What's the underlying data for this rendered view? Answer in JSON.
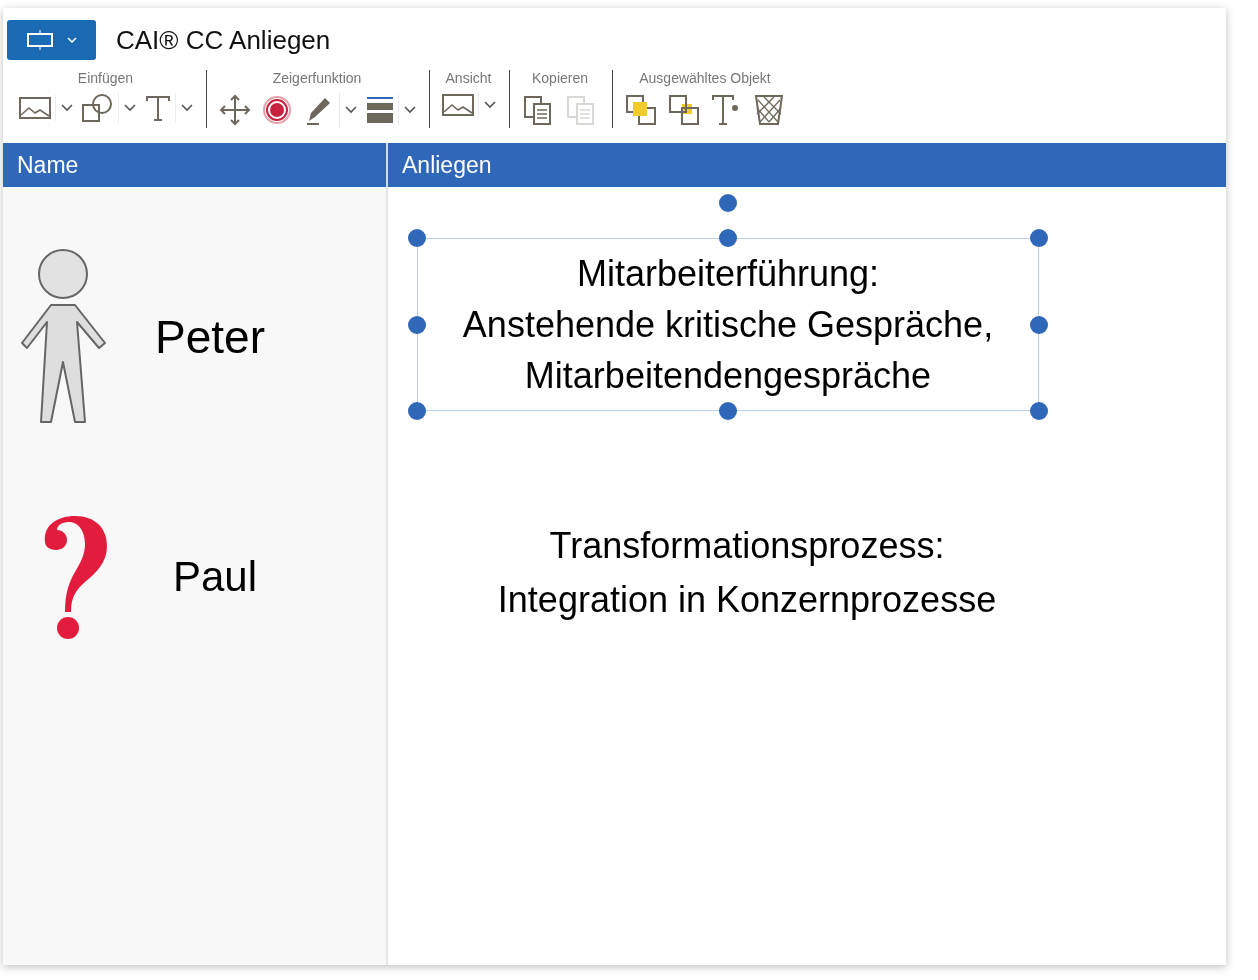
{
  "app_title": "CAI® CC Anliegen",
  "toolbar": [
    {
      "label": "Einfügen",
      "tools": [
        {
          "kind": "image",
          "dropdown": true,
          "disabled": false
        },
        {
          "kind": "shape",
          "dropdown": true,
          "disabled": false
        },
        {
          "kind": "text",
          "dropdown": true,
          "disabled": false
        }
      ]
    },
    {
      "label": "Zeigerfunktion",
      "tools": [
        {
          "kind": "move",
          "dropdown": false,
          "disabled": false
        },
        {
          "kind": "target",
          "dropdown": false,
          "disabled": false
        },
        {
          "kind": "pen",
          "dropdown": true,
          "disabled": false
        },
        {
          "kind": "lines",
          "dropdown": true,
          "disabled": false
        }
      ]
    },
    {
      "label": "Ansicht",
      "tools": [
        {
          "kind": "image",
          "dropdown": true,
          "disabled": false
        }
      ]
    },
    {
      "label": "Kopieren",
      "tools": [
        {
          "kind": "copy",
          "dropdown": false,
          "disabled": false
        },
        {
          "kind": "paste",
          "dropdown": false,
          "disabled": true
        }
      ]
    },
    {
      "label": "Ausgewähltes Objekt",
      "tools": [
        {
          "kind": "front",
          "dropdown": false,
          "disabled": false
        },
        {
          "kind": "back",
          "dropdown": false,
          "disabled": false
        },
        {
          "kind": "textformat",
          "dropdown": false,
          "disabled": false
        },
        {
          "kind": "delete",
          "dropdown": false,
          "disabled": false
        }
      ]
    }
  ],
  "columns": [
    "Name",
    "Anliegen"
  ],
  "rows": [
    {
      "name": "Peter",
      "kind": "person",
      "concern": "Mitarbeiterführung:\nAnstehende kritische Gespräche,\nMitarbeitendengespräche",
      "selected": true
    },
    {
      "name": "Paul",
      "kind": "question",
      "concern": "Transformationsprozess:\nIntegration in Konzernprozesse",
      "selected": false
    }
  ]
}
